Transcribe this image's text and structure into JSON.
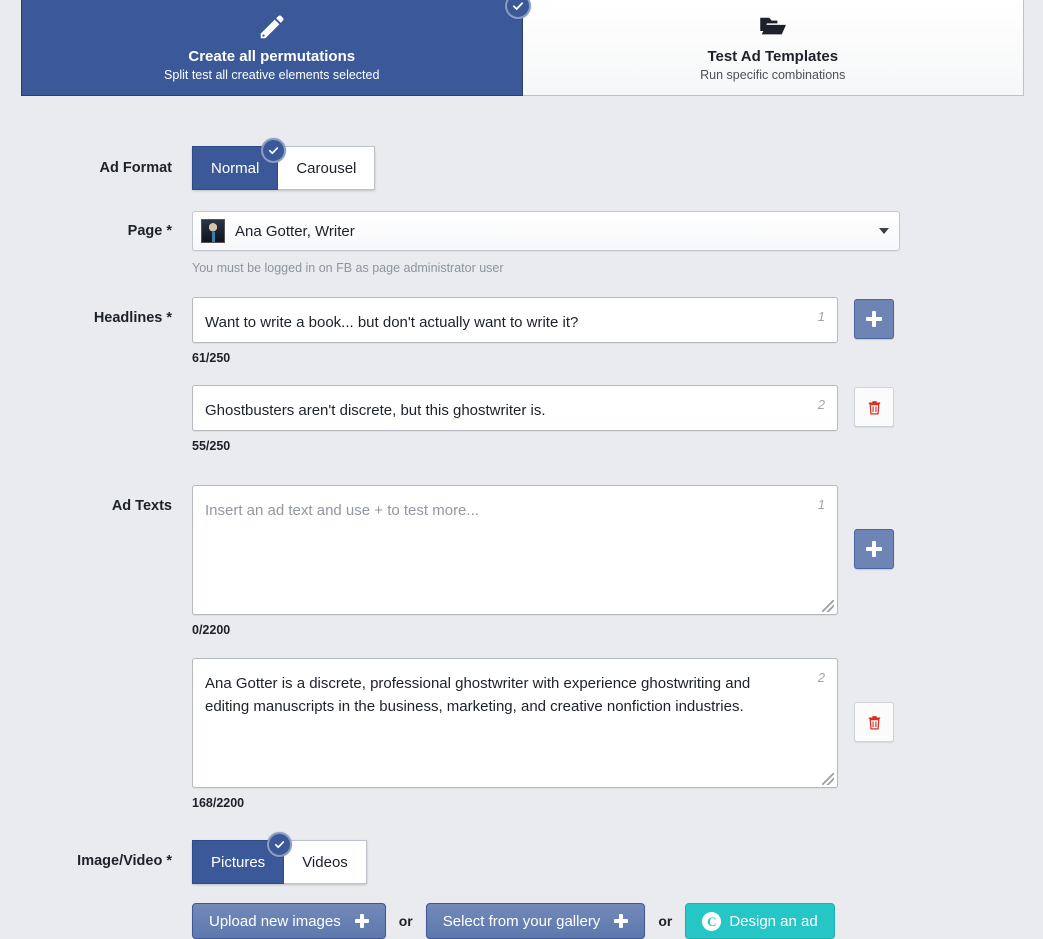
{
  "mode_tabs": [
    {
      "title": "Create all permutations",
      "subtitle": "Split test all creative elements selected",
      "icon": "pencil-icon",
      "selected": true
    },
    {
      "title": "Test Ad Templates",
      "subtitle": "Run specific combinations",
      "icon": "folder-icon",
      "selected": false
    }
  ],
  "form": {
    "ad_format": {
      "label": "Ad Format",
      "options": [
        "Normal",
        "Carousel"
      ],
      "selected": "Normal"
    },
    "page": {
      "label": "Page *",
      "value": "Ana Gotter, Writer",
      "helper": "You must be logged in on FB as page administrator user"
    },
    "headlines": {
      "label": "Headlines *",
      "items": [
        {
          "value": "Want to write a book... but don't actually want to write it?",
          "index": "1",
          "counter": "61/250",
          "action": "add"
        },
        {
          "value": "Ghostbusters aren't discrete, but this ghostwriter is.",
          "index": "2",
          "counter": "55/250",
          "action": "delete"
        }
      ]
    },
    "ad_texts": {
      "label": "Ad Texts",
      "items": [
        {
          "value": "",
          "placeholder": "Insert an ad text and use + to test more...",
          "index": "1",
          "counter": "0/2200",
          "action": "add"
        },
        {
          "value": "Ana Gotter is a discrete, professional ghostwriter with experience ghostwriting and editing manuscripts in the business, marketing, and creative nonfiction industries.",
          "placeholder": "",
          "index": "2",
          "counter": "168/2200",
          "action": "delete"
        }
      ]
    },
    "image_video": {
      "label": "Image/Video *",
      "options": [
        "Pictures",
        "Videos"
      ],
      "selected": "Pictures",
      "buttons": {
        "upload": "Upload new images",
        "gallery": "Select from your gallery",
        "design": "Design an ad",
        "design_icon_letter": "C",
        "separator": "or"
      }
    }
  },
  "colors": {
    "background": "#e9ebee",
    "facebook_blue": "#3b5998",
    "button_blue": "#6d84b4",
    "teal": "#26c6c6",
    "delete_red": "#d93025"
  }
}
